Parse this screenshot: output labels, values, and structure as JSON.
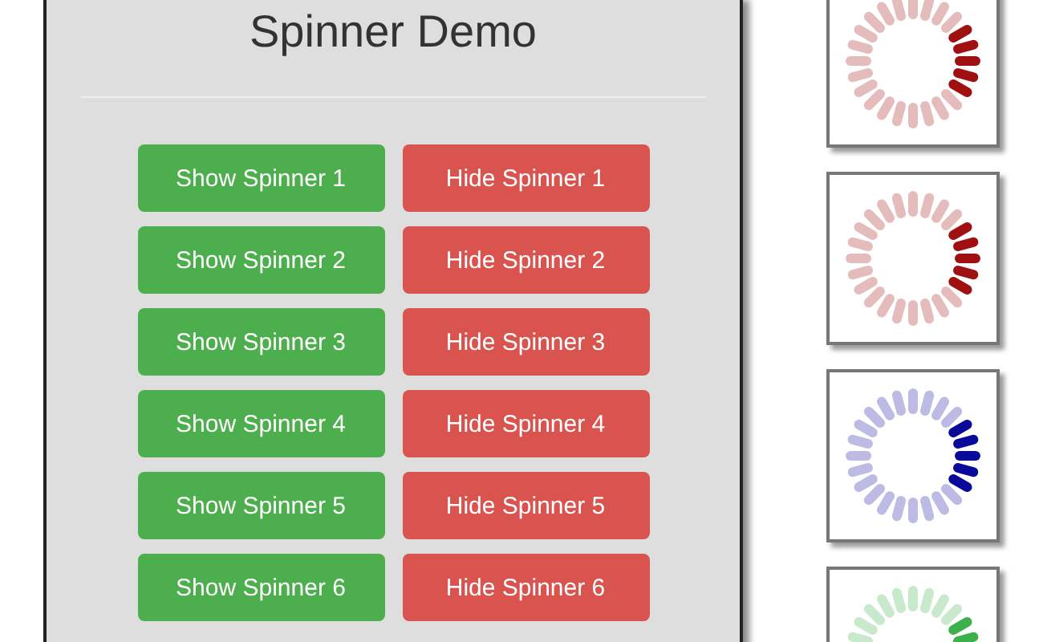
{
  "title": "Spinner Demo",
  "rows": [
    {
      "show": "Show Spinner 1",
      "hide": "Hide Spinner 1"
    },
    {
      "show": "Show Spinner 2",
      "hide": "Hide Spinner 2"
    },
    {
      "show": "Show Spinner 3",
      "hide": "Hide Spinner 3"
    },
    {
      "show": "Show Spinner 4",
      "hide": "Hide Spinner 4"
    },
    {
      "show": "Show Spinner 5",
      "hide": "Hide Spinner 5"
    },
    {
      "show": "Show Spinner 6",
      "hide": "Hide Spinner 6"
    }
  ],
  "spinners": [
    {
      "color": "#a01010"
    },
    {
      "color": "#a01010"
    },
    {
      "color": "#0a0a9a"
    },
    {
      "color": "#3cb04a"
    }
  ]
}
